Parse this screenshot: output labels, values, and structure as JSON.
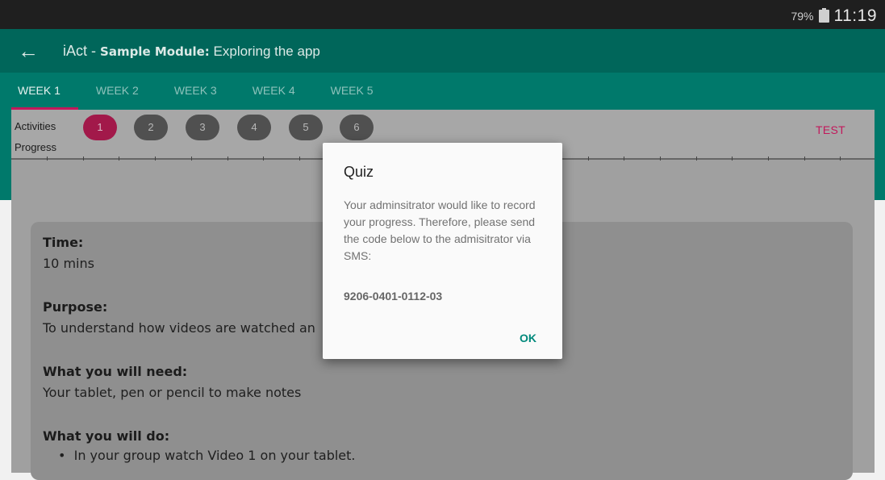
{
  "status_bar": {
    "battery": "79%",
    "time": "11:19"
  },
  "app_bar": {
    "back_icon": "arrow-left-icon",
    "app_name": "iAct - ",
    "module_label": "Sample Module:",
    "module_title": " Exploring the app"
  },
  "tabs": [
    "WEEK 1",
    "WEEK 2",
    "WEEK 3",
    "WEEK 4",
    "WEEK 5"
  ],
  "active_tab": "WEEK 1",
  "activities": {
    "label": "Activities",
    "progress_label": "Progress",
    "steps": [
      "1",
      "2",
      "3",
      "4",
      "5",
      "6"
    ],
    "current_step": "1",
    "test_label": "TEST"
  },
  "content": {
    "time_heading": "Time:",
    "time_value": "10 mins",
    "purpose_heading": "Purpose:",
    "purpose_value": "To understand how videos are watched an",
    "need_heading": "What you will need:",
    "need_value": "Your tablet, pen or pencil to make notes",
    "do_heading": "What you will do:",
    "do_items": [
      "In your group watch Video 1 on your tablet."
    ]
  },
  "dialog": {
    "title": "Quiz",
    "message": "Your adminsitrator would like to record your progress. Therefore, please send the code below to the admisitrator via SMS:",
    "code": "9206-0401-0112-03",
    "ok_label": "OK"
  },
  "colors": {
    "app_bar": "#00665a",
    "tabs_bar": "#00796b",
    "accent": "#c2185b",
    "dialog_button": "#00897b"
  }
}
